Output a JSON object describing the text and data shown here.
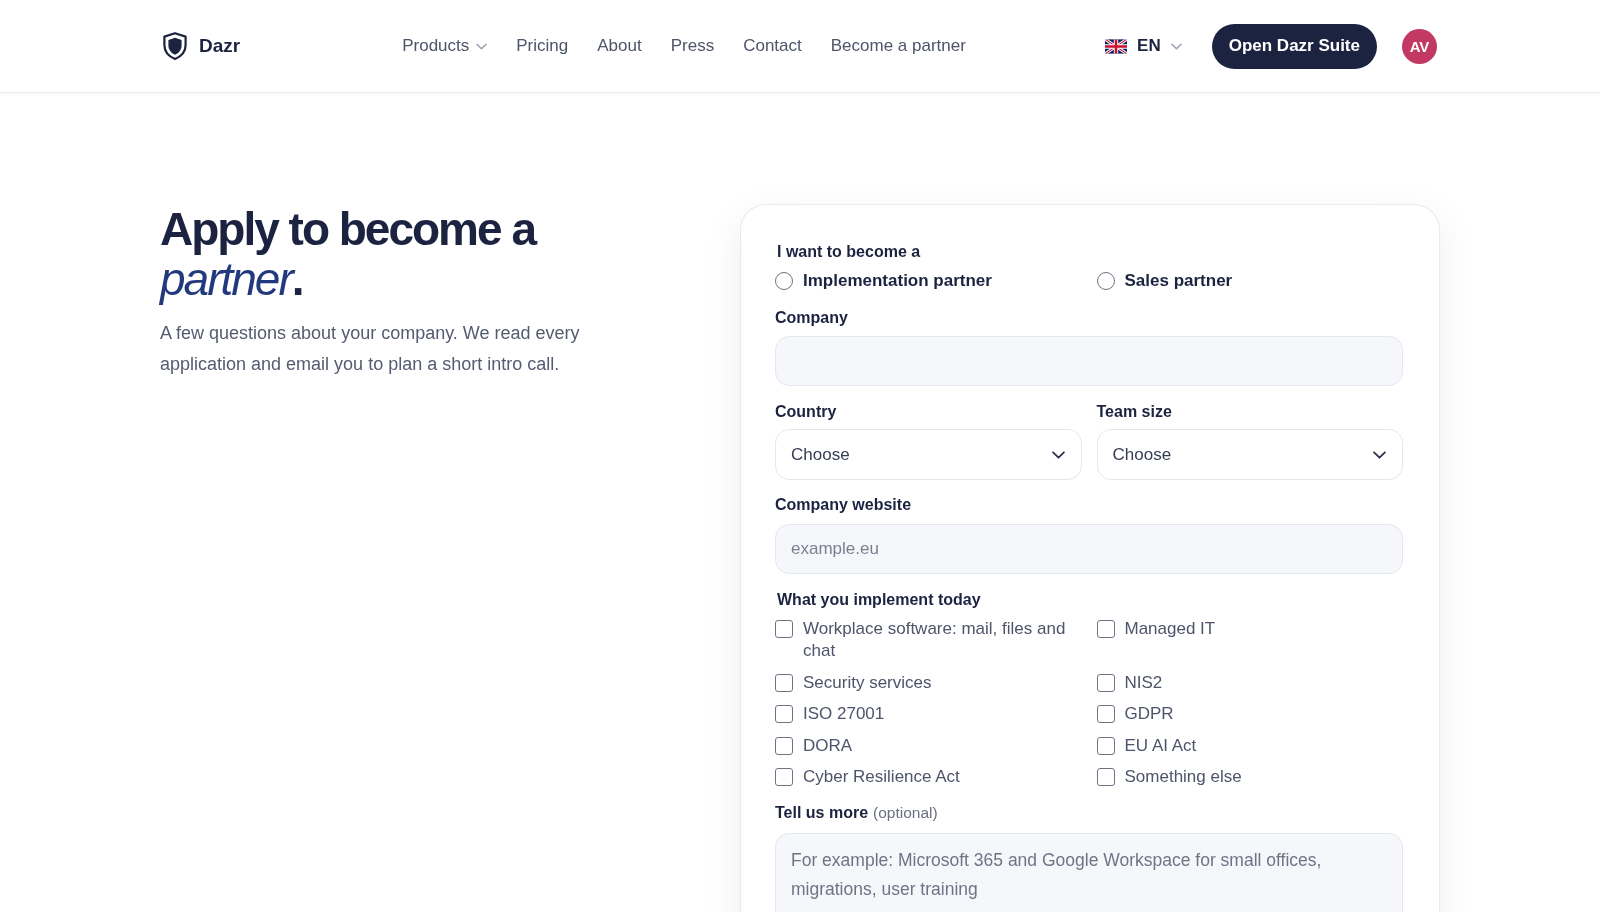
{
  "header": {
    "brand": "Dazr",
    "nav": [
      {
        "label": "Products",
        "kind": "dropdown"
      },
      {
        "label": "Pricing",
        "kind": "link"
      },
      {
        "label": "About",
        "kind": "link"
      },
      {
        "label": "Press",
        "kind": "link"
      },
      {
        "label": "Contact",
        "kind": "link"
      },
      {
        "label": "Become a partner",
        "kind": "link"
      }
    ],
    "language": "EN",
    "cta": "Open Dazr Suite",
    "avatar": "AV"
  },
  "hero": {
    "title": "Apply to become a *partner*.",
    "intro": "A few questions about your company. We read every application and email you to plan a short intro call."
  },
  "form": {
    "role": {
      "label": "I want to become a",
      "options": [
        {
          "label": "Implementation partner",
          "selected": false
        },
        {
          "label": "Sales partner",
          "selected": false
        }
      ]
    },
    "company": {
      "label": "Company"
    },
    "country": {
      "label": "Country",
      "value": "Choose"
    },
    "team_size": {
      "label": "Team size",
      "value": "Choose"
    },
    "website": {
      "label": "Company website",
      "placeholder": "example.eu"
    },
    "implements": {
      "label": "What you implement today",
      "options": [
        {
          "label": "Workplace software: mail, files and chat",
          "checked": false
        },
        {
          "label": "Managed IT",
          "checked": false
        },
        {
          "label": "Security services",
          "checked": false
        },
        {
          "label": "NIS2",
          "checked": false
        },
        {
          "label": "ISO 27001",
          "checked": false
        },
        {
          "label": "GDPR",
          "checked": false
        },
        {
          "label": "DORA",
          "checked": false
        },
        {
          "label": "EU AI Act",
          "checked": false
        },
        {
          "label": "Cyber Resilience Act",
          "checked": false
        },
        {
          "label": "Something else",
          "checked": false
        }
      ]
    },
    "notes": {
      "label": "Tell us more",
      "hint": "(optional)",
      "placeholder": "For example: Microsoft 365 and Google Workspace for small offices, migrations, user training"
    }
  }
}
